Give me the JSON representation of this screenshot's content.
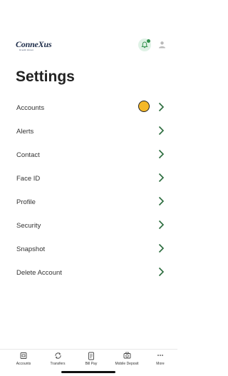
{
  "header": {
    "logo_text": "ConneXus",
    "logo_subtext": "Credit Union"
  },
  "page": {
    "title": "Settings"
  },
  "settings_items": [
    {
      "label": "Accounts"
    },
    {
      "label": "Alerts"
    },
    {
      "label": "Contact"
    },
    {
      "label": "Face ID"
    },
    {
      "label": "Profile"
    },
    {
      "label": "Security"
    },
    {
      "label": "Snapshot"
    },
    {
      "label": "Delete Account"
    }
  ],
  "tabbar": {
    "items": [
      {
        "label": "Accounts",
        "icon": "accounts-icon"
      },
      {
        "label": "Transfers",
        "icon": "transfers-icon"
      },
      {
        "label": "Bill Pay",
        "icon": "bill-pay-icon"
      },
      {
        "label": "Mobile Deposit",
        "icon": "camera-icon"
      },
      {
        "label": "More",
        "icon": "more-icon"
      }
    ]
  },
  "colors": {
    "accent_green": "#2f8f4a",
    "chevron": "#2a6b3c",
    "cursor": "#f4b82a"
  }
}
